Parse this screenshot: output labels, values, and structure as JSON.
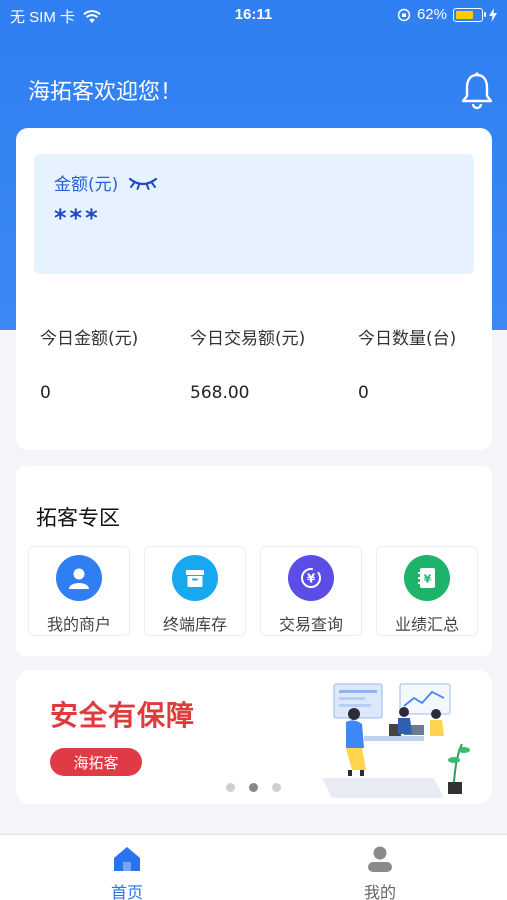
{
  "status_bar": {
    "carrier": "无 SIM 卡",
    "time": "16:11",
    "battery_percent": "62%",
    "battery_level": 0.62
  },
  "header": {
    "welcome": "海拓客欢迎您！"
  },
  "balance": {
    "label": "金额(元)",
    "value": "***",
    "stats": [
      {
        "label": "今日金额(元)",
        "value": "0"
      },
      {
        "label": "今日交易额(元)",
        "value": "568.00"
      },
      {
        "label": "今日数量(台)",
        "value": "0"
      }
    ]
  },
  "zone": {
    "title": "拓客专区",
    "items": [
      {
        "label": "我的商户",
        "icon": "merchant-icon",
        "color": "#2f7ff2"
      },
      {
        "label": "终端库存",
        "icon": "inventory-icon",
        "color": "#18a8f0"
      },
      {
        "label": "交易查询",
        "icon": "transaction-icon",
        "color": "#5a4ee6"
      },
      {
        "label": "业绩汇总",
        "icon": "performance-icon",
        "color": "#1db36b"
      }
    ]
  },
  "banner": {
    "title": "安全有保障",
    "tag": "海拓客",
    "active_dot": 1
  },
  "tabbar": {
    "home": "首页",
    "mine": "我的"
  },
  "colors": {
    "primary": "#2f7ff2",
    "accent_red": "#e03a3a"
  }
}
